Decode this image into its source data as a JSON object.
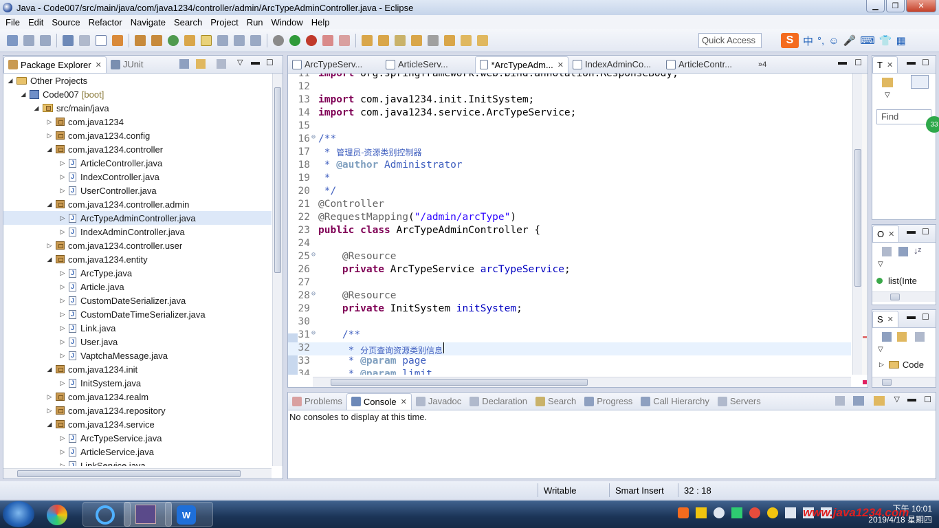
{
  "window": {
    "title": "Java - Code007/src/main/java/com/java1234/controller/admin/ArcTypeAdminController.java - Eclipse"
  },
  "menu": [
    "File",
    "Edit",
    "Source",
    "Refactor",
    "Navigate",
    "Search",
    "Project",
    "Run",
    "Window",
    "Help"
  ],
  "toolbar": {
    "quick_access": "Quick Access",
    "ime_labels": [
      "中",
      "°,",
      "☺",
      "🎤",
      "⌨",
      "👕",
      "▦"
    ]
  },
  "package_explorer": {
    "tabs": [
      "Package Explorer",
      "JUnit"
    ],
    "tree": [
      {
        "label": "Other Projects",
        "depth": 0,
        "icon": "folder",
        "twisty": "open"
      },
      {
        "label": "Code007",
        "suffix": "[boot]",
        "depth": 1,
        "icon": "project",
        "twisty": "open"
      },
      {
        "label": "src/main/java",
        "depth": 2,
        "icon": "source-folder",
        "twisty": "open"
      },
      {
        "label": "com.java1234",
        "depth": 3,
        "icon": "package",
        "twisty": "closed"
      },
      {
        "label": "com.java1234.config",
        "depth": 3,
        "icon": "package",
        "twisty": "closed"
      },
      {
        "label": "com.java1234.controller",
        "depth": 3,
        "icon": "package",
        "twisty": "open"
      },
      {
        "label": "ArticleController.java",
        "depth": 4,
        "icon": "java",
        "twisty": "closed"
      },
      {
        "label": "IndexController.java",
        "depth": 4,
        "icon": "java",
        "twisty": "closed"
      },
      {
        "label": "UserController.java",
        "depth": 4,
        "icon": "java",
        "twisty": "closed"
      },
      {
        "label": "com.java1234.controller.admin",
        "depth": 3,
        "icon": "package",
        "twisty": "open"
      },
      {
        "label": "ArcTypeAdminController.java",
        "depth": 4,
        "icon": "java",
        "twisty": "closed",
        "selected": true
      },
      {
        "label": "IndexAdminController.java",
        "depth": 4,
        "icon": "java",
        "twisty": "closed"
      },
      {
        "label": "com.java1234.controller.user",
        "depth": 3,
        "icon": "package",
        "twisty": "closed"
      },
      {
        "label": "com.java1234.entity",
        "depth": 3,
        "icon": "package",
        "twisty": "open"
      },
      {
        "label": "ArcType.java",
        "depth": 4,
        "icon": "java",
        "twisty": "closed"
      },
      {
        "label": "Article.java",
        "depth": 4,
        "icon": "java",
        "twisty": "closed"
      },
      {
        "label": "CustomDateSerializer.java",
        "depth": 4,
        "icon": "java",
        "twisty": "closed"
      },
      {
        "label": "CustomDateTimeSerializer.java",
        "depth": 4,
        "icon": "java",
        "twisty": "closed"
      },
      {
        "label": "Link.java",
        "depth": 4,
        "icon": "java",
        "twisty": "closed"
      },
      {
        "label": "User.java",
        "depth": 4,
        "icon": "java",
        "twisty": "closed"
      },
      {
        "label": "VaptchaMessage.java",
        "depth": 4,
        "icon": "java",
        "twisty": "closed"
      },
      {
        "label": "com.java1234.init",
        "depth": 3,
        "icon": "package",
        "twisty": "open"
      },
      {
        "label": "InitSystem.java",
        "depth": 4,
        "icon": "java",
        "twisty": "closed"
      },
      {
        "label": "com.java1234.realm",
        "depth": 3,
        "icon": "package",
        "twisty": "closed"
      },
      {
        "label": "com.java1234.repository",
        "depth": 3,
        "icon": "package",
        "twisty": "closed"
      },
      {
        "label": "com.java1234.service",
        "depth": 3,
        "icon": "package",
        "twisty": "open"
      },
      {
        "label": "ArcTypeService.java",
        "depth": 4,
        "icon": "java",
        "twisty": "closed"
      },
      {
        "label": "ArticleService.java",
        "depth": 4,
        "icon": "java",
        "twisty": "closed"
      },
      {
        "label": "LinkService.java",
        "depth": 4,
        "icon": "java",
        "twisty": "closed"
      }
    ]
  },
  "editor": {
    "tabs": [
      {
        "label": "ArcTypeServ..."
      },
      {
        "label": "ArticleServ..."
      },
      {
        "label": "*ArcTypeAdm...",
        "active": true
      },
      {
        "label": "IndexAdminCo..."
      },
      {
        "label": "ArticleContr..."
      }
    ],
    "overflow_count": "»4",
    "lines": [
      {
        "n": "11",
        "segs": [
          [
            "kw",
            "import"
          ],
          [
            "",
            "org.springframework.web.bind.annotation.ResponseBody;"
          ]
        ]
      },
      {
        "n": "12",
        "segs": []
      },
      {
        "n": "13",
        "segs": [
          [
            "kw",
            "import"
          ],
          [
            "",
            "com.java1234.init.InitSystem;"
          ]
        ]
      },
      {
        "n": "14",
        "segs": [
          [
            "kw",
            "import"
          ],
          [
            "",
            "com.java1234.service.ArcTypeService;"
          ]
        ]
      },
      {
        "n": "15",
        "segs": []
      },
      {
        "n": "16",
        "fold": "⊖",
        "segs": [
          [
            "cm",
            "/**"
          ]
        ]
      },
      {
        "n": "17",
        "segs": [
          [
            "cm",
            " * "
          ],
          [
            "cm cjk",
            "管理员-资源类别控制器"
          ]
        ]
      },
      {
        "n": "18",
        "segs": [
          [
            "cm",
            " * "
          ],
          [
            "cmtag",
            "@author"
          ],
          [
            "cm",
            " Administrator"
          ]
        ]
      },
      {
        "n": "19",
        "segs": [
          [
            "cm",
            " *"
          ]
        ]
      },
      {
        "n": "20",
        "segs": [
          [
            "cm",
            " */"
          ]
        ]
      },
      {
        "n": "21",
        "segs": [
          [
            "an",
            "@Controller"
          ]
        ]
      },
      {
        "n": "22",
        "segs": [
          [
            "an",
            "@RequestMapping"
          ],
          [
            "",
            "("
          ],
          [
            "st",
            "\"/admin/arcType\""
          ],
          [
            "",
            ")"
          ]
        ]
      },
      {
        "n": "23",
        "segs": [
          [
            "kw",
            "public"
          ],
          [
            "",
            " "
          ],
          [
            "kw",
            "class"
          ],
          [
            "",
            " ArcTypeAdminController {"
          ]
        ]
      },
      {
        "n": "24",
        "segs": []
      },
      {
        "n": "25",
        "fold": "⊖",
        "segs": [
          [
            "",
            "    "
          ],
          [
            "an",
            "@Resource"
          ]
        ]
      },
      {
        "n": "26",
        "segs": [
          [
            "",
            "    "
          ],
          [
            "kw",
            "private"
          ],
          [
            "",
            " ArcTypeService "
          ],
          [
            "fld",
            "arcTypeService"
          ],
          [
            "",
            ";"
          ]
        ]
      },
      {
        "n": "27",
        "segs": []
      },
      {
        "n": "28",
        "fold": "⊖",
        "segs": [
          [
            "",
            "    "
          ],
          [
            "an",
            "@Resource"
          ]
        ]
      },
      {
        "n": "29",
        "segs": [
          [
            "",
            "    "
          ],
          [
            "kw",
            "private"
          ],
          [
            "",
            " InitSystem "
          ],
          [
            "fld",
            "initSystem"
          ],
          [
            "",
            ";"
          ]
        ]
      },
      {
        "n": "30",
        "segs": []
      },
      {
        "n": "31",
        "fold": "⊖",
        "segs": [
          [
            "",
            "    "
          ],
          [
            "cm",
            "/**"
          ]
        ]
      },
      {
        "n": "32",
        "current": true,
        "segs": [
          [
            "cm",
            "     * "
          ],
          [
            "cm cjk",
            "分页查询资源类别信息"
          ]
        ]
      },
      {
        "n": "33",
        "segs": [
          [
            "cm",
            "     * "
          ],
          [
            "cmtag",
            "@param"
          ],
          [
            "cm",
            " page"
          ]
        ]
      },
      {
        "n": "34",
        "segs": [
          [
            "cm",
            "     * "
          ],
          [
            "cmtag",
            "@param"
          ],
          [
            "cm",
            " limit"
          ]
        ]
      }
    ]
  },
  "right_panels": {
    "task_tab": "T",
    "find_placeholder": "Find",
    "outline_tab": "O",
    "outline_item": "list(Inte",
    "servers_tab": "S",
    "servers_item": "Code",
    "badge": "33"
  },
  "console": {
    "tabs": [
      "Problems",
      "Console",
      "Javadoc",
      "Declaration",
      "Search",
      "Progress",
      "Call Hierarchy",
      "Servers"
    ],
    "active_tab": "Console",
    "message": "No consoles to display at this time."
  },
  "status": {
    "writable": "Writable",
    "insert_mode": "Smart Insert",
    "position": "32 : 18"
  },
  "taskbar": {
    "time": "下午 10:01",
    "date": "2019/4/18 星期四",
    "watermark": "www.java1234.com"
  }
}
